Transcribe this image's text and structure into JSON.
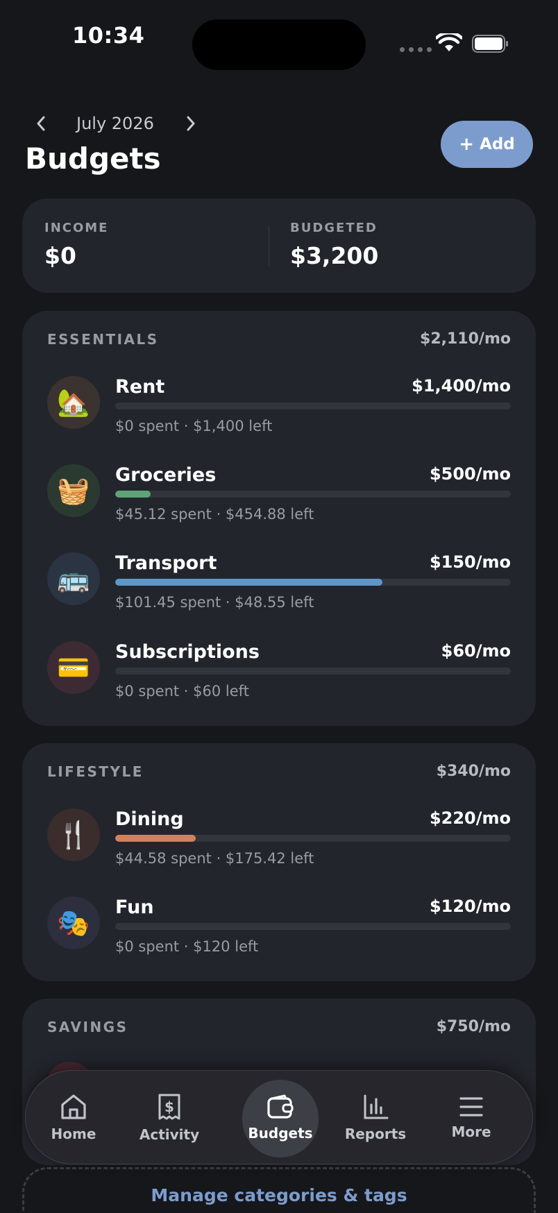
{
  "status_bar": {
    "time": "10:34"
  },
  "header": {
    "month": "July 2026",
    "title": "Budgets",
    "add_label": "Add"
  },
  "summary": {
    "income_label": "INCOME",
    "income_value": "$0",
    "budgeted_label": "BUDGETED",
    "budgeted_value": "$3,200"
  },
  "groups": [
    {
      "name": "ESSENTIALS",
      "total": "$2,110/mo",
      "items": [
        {
          "name": "Rent",
          "amount": "$1,400/mo",
          "sub": "$0 spent · $1,400 left",
          "progress": 0,
          "bar_color": "#5e6068",
          "icon": "house-key-icon",
          "glyph": "🏡",
          "icon_bg": "#3a3330"
        },
        {
          "name": "Groceries",
          "amount": "$500/mo",
          "sub": "$45.12 spent · $454.88 left",
          "progress": 0.09,
          "bar_color": "#5fa37a",
          "icon": "basket-icon",
          "glyph": "🧺",
          "icon_bg": "#2b3a31"
        },
        {
          "name": "Transport",
          "amount": "$150/mo",
          "sub": "$101.45 spent · $48.55 left",
          "progress": 0.676,
          "bar_color": "#5d97c7",
          "icon": "bus-icon",
          "glyph": "🚌",
          "icon_bg": "#2a3443"
        },
        {
          "name": "Subscriptions",
          "amount": "$60/mo",
          "sub": "$0 spent · $60 left",
          "progress": 0,
          "bar_color": "#5e6068",
          "icon": "credit-card-icon",
          "glyph": "💳",
          "icon_bg": "#3d2a33"
        }
      ]
    },
    {
      "name": "LIFESTYLE",
      "total": "$340/mo",
      "items": [
        {
          "name": "Dining",
          "amount": "$220/mo",
          "sub": "$44.58 spent · $175.42 left",
          "progress": 0.203,
          "bar_color": "#d4805a",
          "icon": "fork-spoon-icon",
          "glyph": "🍴",
          "icon_bg": "#3a2d2b"
        },
        {
          "name": "Fun",
          "amount": "$120/mo",
          "sub": "$0 spent · $120 left",
          "progress": 0,
          "bar_color": "#5e6068",
          "icon": "theater-masks-icon",
          "glyph": "🎭",
          "icon_bg": "#2d2e3e"
        }
      ]
    },
    {
      "name": "SAVINGS",
      "total": "$750/mo",
      "items": []
    }
  ],
  "nav": [
    {
      "label": "Home",
      "icon": "home-icon",
      "active": false
    },
    {
      "label": "Activity",
      "icon": "receipt-icon",
      "active": false
    },
    {
      "label": "Budgets",
      "icon": "wallet-icon",
      "active": true
    },
    {
      "label": "Reports",
      "icon": "bar-chart-icon",
      "active": false
    },
    {
      "label": "More",
      "icon": "menu-icon",
      "active": false
    }
  ],
  "footer": {
    "manage_label": "Manage categories & tags"
  }
}
